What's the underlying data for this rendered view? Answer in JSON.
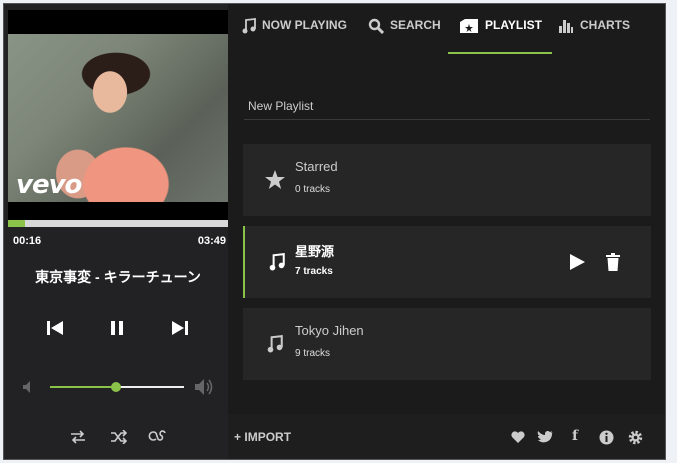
{
  "player": {
    "video_watermark": "vevo",
    "progress_fraction": 0.075,
    "current_time": "00:16",
    "total_time": "03:49",
    "track_title": "東京事変 - キラーチューン",
    "volume_fraction": 0.49
  },
  "tabs": [
    {
      "label": "NOW PLAYING",
      "icon": "music-note-icon"
    },
    {
      "label": "SEARCH",
      "icon": "search-icon"
    },
    {
      "label": "PLAYLIST",
      "icon": "playlist-icon",
      "active": true
    },
    {
      "label": "CHARTS",
      "icon": "bar-chart-icon"
    }
  ],
  "new_playlist_placeholder": "New Playlist",
  "playlists": [
    {
      "name": "Starred",
      "count": "0 tracks",
      "icon": "star-icon"
    },
    {
      "name": "星野源",
      "count": "7 tracks",
      "icon": "music-note-icon",
      "active": true
    },
    {
      "name": "Tokyo Jihen",
      "count": "9 tracks",
      "icon": "music-note-icon"
    }
  ],
  "footer": {
    "import_label": "IMPORT",
    "facebook_glyph": "f"
  },
  "colors": {
    "accent": "#8bc34a",
    "background": "#1b1b1c",
    "card": "#262627"
  }
}
